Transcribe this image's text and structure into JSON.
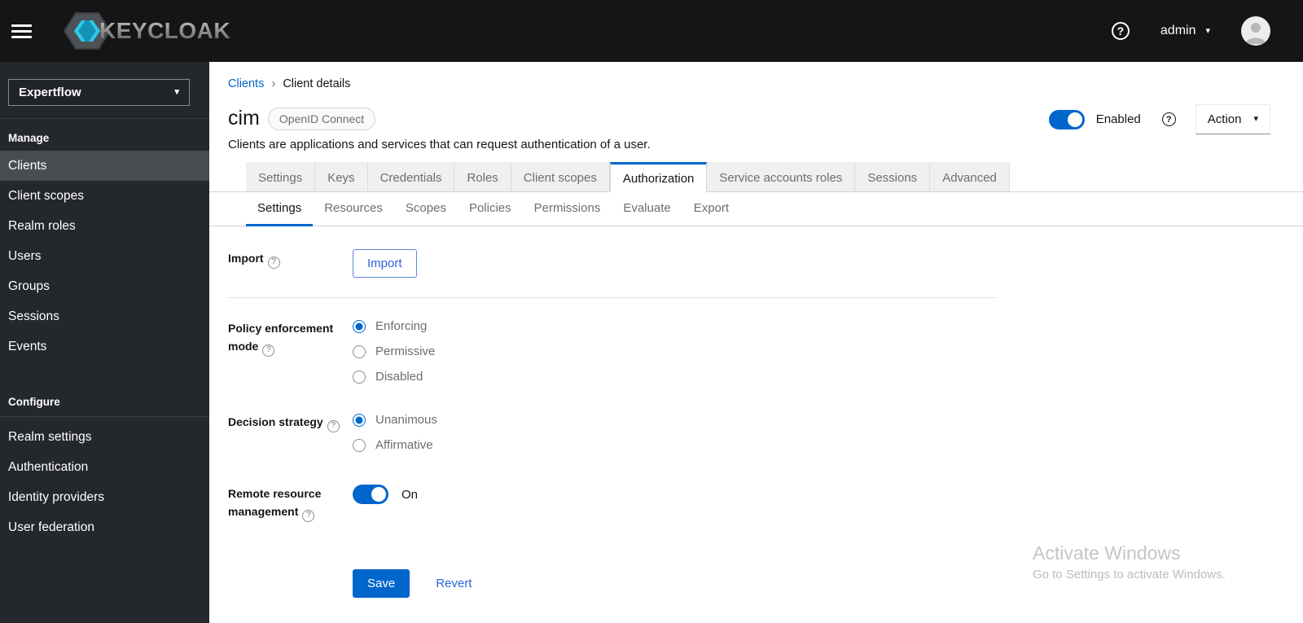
{
  "topbar": {
    "brand": "KEYCLOAK",
    "username": "admin"
  },
  "icons": {
    "help": "?",
    "caret_down": "▾",
    "breadcrumb_sep": "›"
  },
  "sidebar": {
    "realm": "Expertflow",
    "sections": [
      {
        "label": "Manage",
        "items": [
          "Clients",
          "Client scopes",
          "Realm roles",
          "Users",
          "Groups",
          "Sessions",
          "Events"
        ]
      },
      {
        "label": "Configure",
        "items": [
          "Realm settings",
          "Authentication",
          "Identity providers",
          "User federation"
        ]
      }
    ]
  },
  "main": {
    "breadcrumb": {
      "link": "Clients",
      "current": "Client details"
    },
    "header": {
      "title": "cim",
      "badge": "OpenID Connect",
      "description": "Clients are applications and services that can request authentication of a user.",
      "enabled_label": "Enabled",
      "action_label": "Action"
    },
    "tabs": [
      "Settings",
      "Keys",
      "Credentials",
      "Roles",
      "Client scopes",
      "Authorization",
      "Service accounts roles",
      "Sessions",
      "Advanced"
    ],
    "active_tab": "Authorization",
    "subtabs": [
      "Settings",
      "Resources",
      "Scopes",
      "Policies",
      "Permissions",
      "Evaluate",
      "Export"
    ],
    "active_subtab": "Settings",
    "form": {
      "import_label": "Import",
      "import_button": "Import",
      "policy_label": "Policy enforcement mode",
      "policy_options": [
        "Enforcing",
        "Permissive",
        "Disabled"
      ],
      "policy_selected": "Enforcing",
      "decision_label": "Decision strategy",
      "decision_options": [
        "Unanimous",
        "Affirmative"
      ],
      "decision_selected": "Unanimous",
      "remote_label": "Remote resource management",
      "remote_state": "On",
      "save": "Save",
      "revert": "Revert"
    },
    "watermark": {
      "line1": "Activate Windows",
      "line2": "Go to Settings to activate Windows."
    }
  },
  "colors": {
    "accent": "#0066cc",
    "topbar_bg": "#151515",
    "sidebar_bg": "#24272b",
    "sidebar_selected": "#4a4d50",
    "tab_inactive_bg": "#f0f0f0",
    "muted_text": "#6a6e73"
  }
}
